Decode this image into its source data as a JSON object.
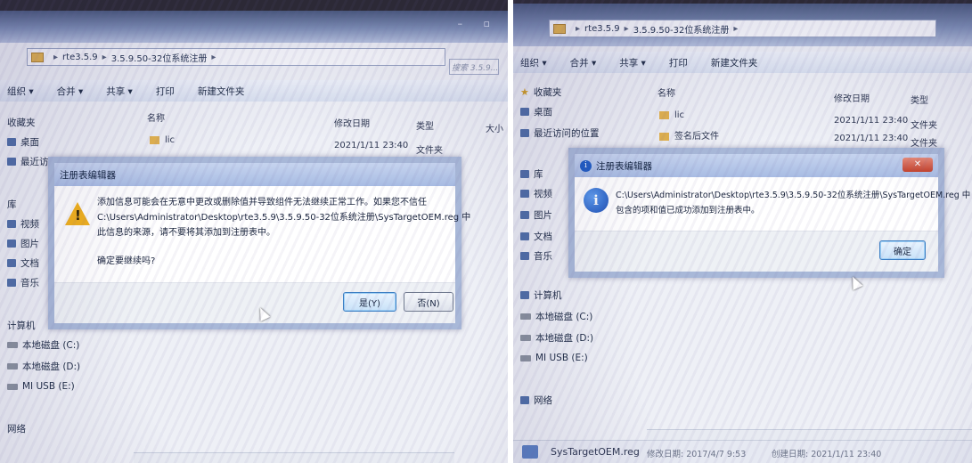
{
  "left": {
    "breadcrumb": [
      "rte3.5.9",
      "3.5.9.50-32位系统注册"
    ],
    "search_placeholder": "搜索 3.5.9...",
    "toolbar": [
      "组织 ▾",
      "合并 ▾",
      "共享 ▾",
      "打印",
      "新建文件夹"
    ],
    "columns": [
      "名称",
      "修改日期",
      "类型",
      "大小"
    ],
    "rows": [
      {
        "name": "lic",
        "date": "2021/1/11 23:40",
        "type": "文件夹"
      }
    ],
    "sidebar": [
      "收藏夹",
      "桌面",
      "最近访问",
      "库",
      "视频",
      "图片",
      "文档",
      "音乐",
      "计算机",
      "本地磁盘 (C:)",
      "本地磁盘 (D:)",
      "MI USB (E:)",
      "网络"
    ],
    "dialog": {
      "title": "注册表编辑器",
      "line1": "添加信息可能会在无意中更改或删除值并导致组件无法继续正常工作。如果您不信任",
      "line2": "C:\\Users\\Administrator\\Desktop\\rte3.5.9\\3.5.9.50-32位系统注册\\SysTargetOEM.reg 中",
      "line3": "此信息的来源，请不要将其添加到注册表中。",
      "question": "确定要继续吗?",
      "yes_label": "是(Y)",
      "no_label": "否(N)"
    }
  },
  "right": {
    "breadcrumb": [
      "rte3.5.9",
      "3.5.9.50-32位系统注册"
    ],
    "toolbar": [
      "组织 ▾",
      "合并 ▾",
      "共享 ▾",
      "打印",
      "新建文件夹"
    ],
    "columns": [
      "名称",
      "修改日期",
      "类型"
    ],
    "rows": [
      {
        "name": "lic",
        "date": "2021/1/11 23:40",
        "type": "文件夹"
      },
      {
        "name": "签名后文件",
        "date": "2021/1/11 23:40",
        "type": "文件夹"
      }
    ],
    "sidebar": [
      "收藏夹",
      "桌面",
      "最近访问的位置",
      "库",
      "视频",
      "图片",
      "文档",
      "音乐",
      "计算机",
      "本地磁盘 (C:)",
      "本地磁盘 (D:)",
      "MI USB (E:)",
      "网络"
    ],
    "dialog": {
      "title": "注册表编辑器",
      "line1": "C:\\Users\\Administrator\\Desktop\\rte3.5.9\\3.5.9.50-32位系统注册\\SysTargetOEM.reg 中",
      "line2": "包含的项和值已成功添加到注册表中。",
      "ok_label": "确定"
    },
    "status": {
      "filename": "SysTargetOEM.reg",
      "modified": "修改日期: 2017/4/7 9:53",
      "created": "创建日期: 2021/1/11 23:40"
    }
  }
}
